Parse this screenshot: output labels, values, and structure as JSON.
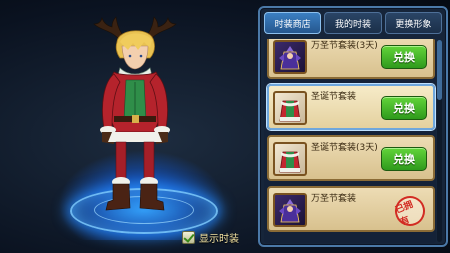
{
  "display": {
    "show_costume_label": "显示时装",
    "show_costume_checked": true
  },
  "tabs": [
    {
      "label": "时装商店",
      "active": true
    },
    {
      "label": "我的时装",
      "active": false
    },
    {
      "label": "更换形象",
      "active": false
    }
  ],
  "items": [
    {
      "name": "万圣节套装(3天)",
      "icon": "halloween-costume-icon",
      "action": "兑换",
      "selected": false
    },
    {
      "name": "圣诞节套装",
      "icon": "christmas-costume-icon",
      "action": "兑换",
      "selected": true
    },
    {
      "name": "圣诞节套装(3天)",
      "icon": "christmas-costume-icon",
      "action": "兑换",
      "selected": false
    },
    {
      "name": "万圣节套装",
      "icon": "halloween-costume-icon",
      "status": "已拥有",
      "selected": false
    }
  ],
  "colors": {
    "panel_border": "#4b79a8",
    "active_tab": "#3b7fc2",
    "exchange_button": "#3fae28",
    "owned_stamp": "#d22b22",
    "platform_glow": "#2896ff"
  }
}
